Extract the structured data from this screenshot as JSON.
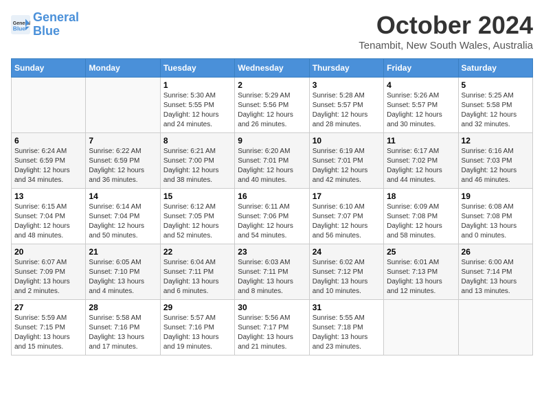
{
  "header": {
    "logo_general": "General",
    "logo_blue": "Blue",
    "month_title": "October 2024",
    "location": "Tenambit, New South Wales, Australia"
  },
  "weekdays": [
    "Sunday",
    "Monday",
    "Tuesday",
    "Wednesday",
    "Thursday",
    "Friday",
    "Saturday"
  ],
  "weeks": [
    [
      {
        "day": "",
        "sunrise": "",
        "sunset": "",
        "daylight": ""
      },
      {
        "day": "",
        "sunrise": "",
        "sunset": "",
        "daylight": ""
      },
      {
        "day": "1",
        "sunrise": "Sunrise: 5:30 AM",
        "sunset": "Sunset: 5:55 PM",
        "daylight": "Daylight: 12 hours and 24 minutes."
      },
      {
        "day": "2",
        "sunrise": "Sunrise: 5:29 AM",
        "sunset": "Sunset: 5:56 PM",
        "daylight": "Daylight: 12 hours and 26 minutes."
      },
      {
        "day": "3",
        "sunrise": "Sunrise: 5:28 AM",
        "sunset": "Sunset: 5:57 PM",
        "daylight": "Daylight: 12 hours and 28 minutes."
      },
      {
        "day": "4",
        "sunrise": "Sunrise: 5:26 AM",
        "sunset": "Sunset: 5:57 PM",
        "daylight": "Daylight: 12 hours and 30 minutes."
      },
      {
        "day": "5",
        "sunrise": "Sunrise: 5:25 AM",
        "sunset": "Sunset: 5:58 PM",
        "daylight": "Daylight: 12 hours and 32 minutes."
      }
    ],
    [
      {
        "day": "6",
        "sunrise": "Sunrise: 6:24 AM",
        "sunset": "Sunset: 6:59 PM",
        "daylight": "Daylight: 12 hours and 34 minutes."
      },
      {
        "day": "7",
        "sunrise": "Sunrise: 6:22 AM",
        "sunset": "Sunset: 6:59 PM",
        "daylight": "Daylight: 12 hours and 36 minutes."
      },
      {
        "day": "8",
        "sunrise": "Sunrise: 6:21 AM",
        "sunset": "Sunset: 7:00 PM",
        "daylight": "Daylight: 12 hours and 38 minutes."
      },
      {
        "day": "9",
        "sunrise": "Sunrise: 6:20 AM",
        "sunset": "Sunset: 7:01 PM",
        "daylight": "Daylight: 12 hours and 40 minutes."
      },
      {
        "day": "10",
        "sunrise": "Sunrise: 6:19 AM",
        "sunset": "Sunset: 7:01 PM",
        "daylight": "Daylight: 12 hours and 42 minutes."
      },
      {
        "day": "11",
        "sunrise": "Sunrise: 6:17 AM",
        "sunset": "Sunset: 7:02 PM",
        "daylight": "Daylight: 12 hours and 44 minutes."
      },
      {
        "day": "12",
        "sunrise": "Sunrise: 6:16 AM",
        "sunset": "Sunset: 7:03 PM",
        "daylight": "Daylight: 12 hours and 46 minutes."
      }
    ],
    [
      {
        "day": "13",
        "sunrise": "Sunrise: 6:15 AM",
        "sunset": "Sunset: 7:04 PM",
        "daylight": "Daylight: 12 hours and 48 minutes."
      },
      {
        "day": "14",
        "sunrise": "Sunrise: 6:14 AM",
        "sunset": "Sunset: 7:04 PM",
        "daylight": "Daylight: 12 hours and 50 minutes."
      },
      {
        "day": "15",
        "sunrise": "Sunrise: 6:12 AM",
        "sunset": "Sunset: 7:05 PM",
        "daylight": "Daylight: 12 hours and 52 minutes."
      },
      {
        "day": "16",
        "sunrise": "Sunrise: 6:11 AM",
        "sunset": "Sunset: 7:06 PM",
        "daylight": "Daylight: 12 hours and 54 minutes."
      },
      {
        "day": "17",
        "sunrise": "Sunrise: 6:10 AM",
        "sunset": "Sunset: 7:07 PM",
        "daylight": "Daylight: 12 hours and 56 minutes."
      },
      {
        "day": "18",
        "sunrise": "Sunrise: 6:09 AM",
        "sunset": "Sunset: 7:08 PM",
        "daylight": "Daylight: 12 hours and 58 minutes."
      },
      {
        "day": "19",
        "sunrise": "Sunrise: 6:08 AM",
        "sunset": "Sunset: 7:08 PM",
        "daylight": "Daylight: 13 hours and 0 minutes."
      }
    ],
    [
      {
        "day": "20",
        "sunrise": "Sunrise: 6:07 AM",
        "sunset": "Sunset: 7:09 PM",
        "daylight": "Daylight: 13 hours and 2 minutes."
      },
      {
        "day": "21",
        "sunrise": "Sunrise: 6:05 AM",
        "sunset": "Sunset: 7:10 PM",
        "daylight": "Daylight: 13 hours and 4 minutes."
      },
      {
        "day": "22",
        "sunrise": "Sunrise: 6:04 AM",
        "sunset": "Sunset: 7:11 PM",
        "daylight": "Daylight: 13 hours and 6 minutes."
      },
      {
        "day": "23",
        "sunrise": "Sunrise: 6:03 AM",
        "sunset": "Sunset: 7:11 PM",
        "daylight": "Daylight: 13 hours and 8 minutes."
      },
      {
        "day": "24",
        "sunrise": "Sunrise: 6:02 AM",
        "sunset": "Sunset: 7:12 PM",
        "daylight": "Daylight: 13 hours and 10 minutes."
      },
      {
        "day": "25",
        "sunrise": "Sunrise: 6:01 AM",
        "sunset": "Sunset: 7:13 PM",
        "daylight": "Daylight: 13 hours and 12 minutes."
      },
      {
        "day": "26",
        "sunrise": "Sunrise: 6:00 AM",
        "sunset": "Sunset: 7:14 PM",
        "daylight": "Daylight: 13 hours and 13 minutes."
      }
    ],
    [
      {
        "day": "27",
        "sunrise": "Sunrise: 5:59 AM",
        "sunset": "Sunset: 7:15 PM",
        "daylight": "Daylight: 13 hours and 15 minutes."
      },
      {
        "day": "28",
        "sunrise": "Sunrise: 5:58 AM",
        "sunset": "Sunset: 7:16 PM",
        "daylight": "Daylight: 13 hours and 17 minutes."
      },
      {
        "day": "29",
        "sunrise": "Sunrise: 5:57 AM",
        "sunset": "Sunset: 7:16 PM",
        "daylight": "Daylight: 13 hours and 19 minutes."
      },
      {
        "day": "30",
        "sunrise": "Sunrise: 5:56 AM",
        "sunset": "Sunset: 7:17 PM",
        "daylight": "Daylight: 13 hours and 21 minutes."
      },
      {
        "day": "31",
        "sunrise": "Sunrise: 5:55 AM",
        "sunset": "Sunset: 7:18 PM",
        "daylight": "Daylight: 13 hours and 23 minutes."
      },
      {
        "day": "",
        "sunrise": "",
        "sunset": "",
        "daylight": ""
      },
      {
        "day": "",
        "sunrise": "",
        "sunset": "",
        "daylight": ""
      }
    ]
  ]
}
